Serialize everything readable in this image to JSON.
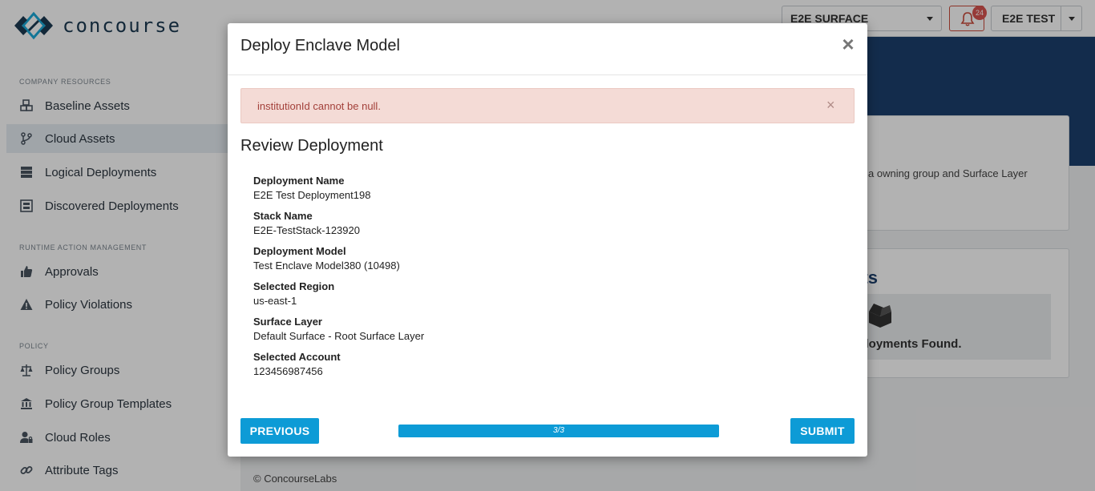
{
  "brand": {
    "name": "concourse"
  },
  "sidebar": {
    "sections": [
      {
        "label": "COMPANY RESOURCES"
      },
      {
        "label": "RUNTIME ACTION MANAGEMENT"
      },
      {
        "label": "POLICY"
      }
    ],
    "items": [
      {
        "label": "Baseline Assets",
        "icon": "cubes-icon"
      },
      {
        "label": "Cloud Assets",
        "icon": "branch-icon",
        "active": true
      },
      {
        "label": "Logical Deployments",
        "icon": "server-icon"
      },
      {
        "label": "Discovered Deployments",
        "icon": "scan-icon"
      },
      {
        "label": "Approvals",
        "icon": "thumbs-up-icon"
      },
      {
        "label": "Policy Violations",
        "icon": "warning-icon"
      },
      {
        "label": "Policy Groups",
        "icon": "balance-scale-icon"
      },
      {
        "label": "Policy Group Templates",
        "icon": "institution-icon"
      },
      {
        "label": "Cloud Roles",
        "icon": "user-lock-icon"
      },
      {
        "label": "Attribute Tags",
        "icon": "link-icon"
      }
    ]
  },
  "topbar": {
    "surface_select": "E2E SURFACE",
    "notifications_count": "24",
    "user_label": "E2E TEST"
  },
  "background": {
    "card1_text": "a owning group and Surface Layer",
    "card2_title": "nts",
    "empty_text": "eployments Found.",
    "footer": "© ConcourseLabs"
  },
  "modal": {
    "title": "Deploy Enclave Model",
    "close_glyph": "×",
    "alert": {
      "text": "institutionId cannot be null.",
      "close_glyph": "×"
    },
    "section_title": "Review Deployment",
    "fields": [
      {
        "label": "Deployment Name",
        "value": "E2E Test Deployment198"
      },
      {
        "label": "Stack Name",
        "value": "E2E-TestStack-123920"
      },
      {
        "label": "Deployment Model",
        "value": "Test Enclave Model380 (10498)"
      },
      {
        "label": "Selected Region",
        "value": "us-east-1"
      },
      {
        "label": "Surface Layer",
        "value": "Default Surface - Root Surface Layer"
      },
      {
        "label": "Selected Account",
        "value": "123456987456"
      }
    ],
    "buttons": {
      "previous": "PREVIOUS",
      "submit": "SUBMIT"
    },
    "progress": {
      "label": "3/3",
      "fraction": 1.0
    }
  },
  "colors": {
    "accent": "#0d9bd6",
    "navy": "#1c3f6e",
    "alert_bg": "#f4dbd6",
    "alert_text": "#a3403a"
  }
}
